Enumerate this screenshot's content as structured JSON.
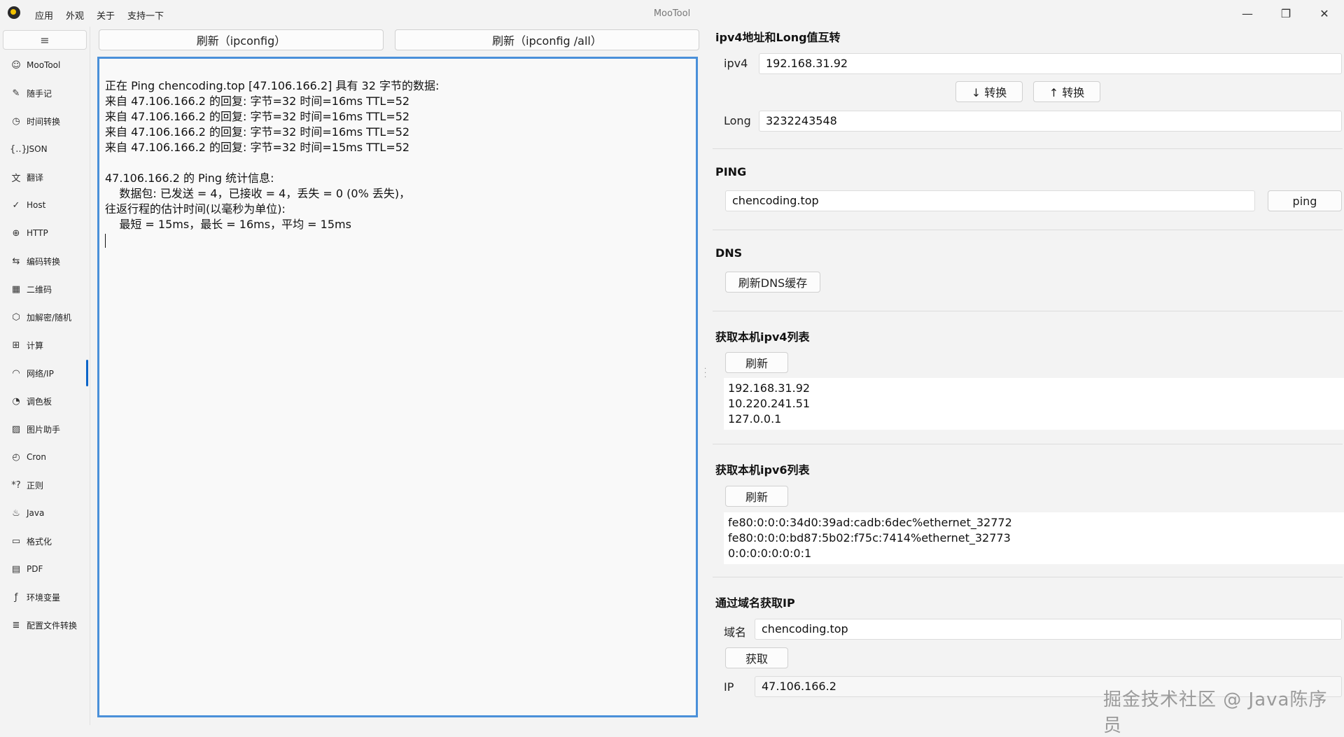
{
  "titlebar": {
    "menu": [
      "应用",
      "外观",
      "关于",
      "支持一下"
    ],
    "title": "MooTool",
    "minimize": "—",
    "maximize": "❐",
    "close": "✕"
  },
  "sidebar": {
    "menu_icon": "≡",
    "items": [
      {
        "icon": "☺",
        "label": "MooTool"
      },
      {
        "icon": "✎",
        "label": "随手记"
      },
      {
        "icon": "◷",
        "label": "时间转换"
      },
      {
        "icon": "{..}",
        "label": "JSON"
      },
      {
        "icon": "文",
        "label": "翻译"
      },
      {
        "icon": "✓",
        "label": "Host"
      },
      {
        "icon": "⊕",
        "label": "HTTP"
      },
      {
        "icon": "⇆",
        "label": "编码转换"
      },
      {
        "icon": "▦",
        "label": "二维码"
      },
      {
        "icon": "⬡",
        "label": "加解密/随机"
      },
      {
        "icon": "⊞",
        "label": "计算"
      },
      {
        "icon": "◠",
        "label": "网络/IP"
      },
      {
        "icon": "◔",
        "label": "调色板"
      },
      {
        "icon": "▨",
        "label": "图片助手"
      },
      {
        "icon": "◴",
        "label": "Cron"
      },
      {
        "icon": "*?",
        "label": "正则"
      },
      {
        "icon": "♨",
        "label": "Java"
      },
      {
        "icon": "▭",
        "label": "格式化"
      },
      {
        "icon": "▤",
        "label": "PDF"
      },
      {
        "icon": "ƒ",
        "label": "环境变量"
      },
      {
        "icon": "≣",
        "label": "配置文件转换"
      }
    ]
  },
  "middle": {
    "btn_ipconfig": "刷新（ipconfig）",
    "btn_ipconfig_all": "刷新（ipconfig /all）",
    "output": "正在 Ping chencoding.top [47.106.166.2] 具有 32 字节的数据:\n来自 47.106.166.2 的回复: 字节=32 时间=16ms TTL=52\n来自 47.106.166.2 的回复: 字节=32 时间=16ms TTL=52\n来自 47.106.166.2 的回复: 字节=32 时间=16ms TTL=52\n来自 47.106.166.2 的回复: 字节=32 时间=15ms TTL=52\n\n47.106.166.2 的 Ping 统计信息:\n    数据包: 已发送 = 4，已接收 = 4，丢失 = 0 (0% 丢失)，\n往返行程的估计时间(以毫秒为单位):\n    最短 = 15ms，最长 = 16ms，平均 = 15ms"
  },
  "ipv4_convert": {
    "title": "ipv4地址和Long值互转",
    "ipv4_label": "ipv4",
    "ipv4_value": "192.168.31.92",
    "down_btn": "↓ 转换",
    "up_btn": "↑ 转换",
    "long_label": "Long",
    "long_value": "3232243548"
  },
  "ping": {
    "title": "PING",
    "host_value": "chencoding.top",
    "btn": "ping"
  },
  "dns": {
    "title": "DNS",
    "btn": "刷新DNS缓存"
  },
  "ipv4_list": {
    "title": "获取本机ipv4列表",
    "btn": "刷新",
    "items": [
      "192.168.31.92",
      "10.220.241.51",
      "127.0.0.1"
    ]
  },
  "ipv6_list": {
    "title": "获取本机ipv6列表",
    "btn": "刷新",
    "items": [
      "fe80:0:0:0:34d0:39ad:cadb:6dec%ethernet_32772",
      "fe80:0:0:0:bd87:5b02:f75c:7414%ethernet_32773",
      "0:0:0:0:0:0:0:1"
    ]
  },
  "domain_ip": {
    "title": "通过域名获取IP",
    "domain_label": "域名",
    "domain_value": "chencoding.top",
    "btn": "获取",
    "ip_label": "IP",
    "ip_value": "47.106.166.2"
  },
  "watermark": "掘金技术社区 @ Java陈序员"
}
